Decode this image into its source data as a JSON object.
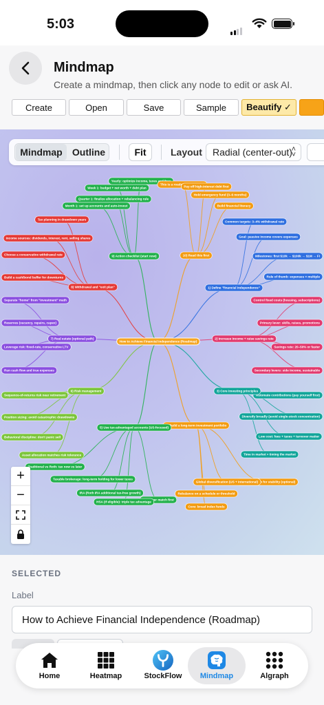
{
  "status": {
    "time": "5:03"
  },
  "header": {
    "title": "Mindmap",
    "subtitle": "Create a mindmap, then click any node to edit or ask AI."
  },
  "toolbar": {
    "create": "Create",
    "open": "Open",
    "save": "Save",
    "sample": "Sample",
    "beautify": "Beautify ✓"
  },
  "view": {
    "mindmap": "Mindmap",
    "outline": "Outline",
    "fit": "Fit",
    "layout_label": "Layout",
    "layout_value": "Radial (center-out)"
  },
  "colors": {
    "root": "#f5a623",
    "blue": "#2f6fe0",
    "pink": "#e23a6e",
    "teal": "#12a59a",
    "orange": "#f39c12",
    "green": "#22b14c",
    "lime": "#7cc53b",
    "purple": "#8a4fe0",
    "red": "#e53935",
    "accent": "#1e88e5"
  },
  "mindmap": {
    "root": "How to Achieve Financial Independence (Roadmap)",
    "branches": [
      {
        "label": "1) Define \"financial independence\"",
        "color": "blue",
        "children": [
          "Common targets: 3–4% withdrawal rate",
          "Goal: passive income covers expenses",
          "Milestones: first $10k → $100k → $1M → FI",
          "Rule of thumb: expenses × multiple"
        ]
      },
      {
        "label": "2) Increase income + raise savings rate",
        "color": "pink",
        "children": [
          "Control fixed costs (housing, subscriptions)",
          "Primary lever: skills, raises, promotions",
          "Savings rate: 20–50% or faster",
          "Secondary levers: side income, sustainable"
        ]
      },
      {
        "label": "3) Core investing principles",
        "color": "teal",
        "children": [
          "Automate contributions (pay yourself first)",
          "Diversify broadly (avoid single-stock concentration)",
          "Low cost: fees + taxes + turnover matter",
          "Time in market > timing the market"
        ]
      },
      {
        "label": "4) Build a long-term investment portfolio",
        "color": "orange",
        "children": [
          "Bond allocation for stability (optional)",
          "Global diversification (US + international)",
          "Rebalance on a schedule or threshold",
          "Core: broad index funds"
        ]
      },
      {
        "label": "5) Use tax-advantaged accounts (US-focused)",
        "color": "green",
        "children": [
          "Employer match first",
          "HSA (if eligible): triple tax advantage",
          "IRA (Roth IRA additional tax-free growth)",
          "Taxable brokerage: long-term holding for lower taxes",
          "Traditional vs Roth: tax now vs later"
        ]
      },
      {
        "label": "6) Risk management",
        "color": "lime",
        "children": [
          "Sequence-of-returns risk near retirement",
          "Position sizing: avoid catastrophic drawdowns",
          "Behavioral discipline: don't panic sell",
          "Asset allocation matches risk tolerance"
        ]
      },
      {
        "label": "7) Real estate (optional path)",
        "color": "purple",
        "children": [
          "Separate \"home\" from \"investment\" math",
          "Reserves (vacancy, repairs, capex)",
          "Leverage risk: fixed-rate, conservative LTV",
          "Run cash flow and true expenses"
        ]
      },
      {
        "label": "8) Withdrawal and \"exit plan\"",
        "color": "red",
        "children": [
          "Tax planning in drawdown years",
          "Income sources: dividends, interest, rent, selling shares",
          "Choose a conservative withdrawal rate",
          "Build a cash/bond buffer for downturns"
        ]
      },
      {
        "label": "9) Action checklist (start now)",
        "color": "green",
        "children": [
          "Week 1: budget + net worth + debt plan",
          "Quarter 1: finalize allocation + rebalancing rule",
          "Month 1: set up accounts and auto-invest",
          "Yearly: optimize income, taxes and fees"
        ]
      },
      {
        "label": "10) Read this first",
        "color": "orange",
        "children": [
          "This is a roadmap, not advice",
          "Pay off high-interest debt first",
          "Hold emergency fund (3–6 months)",
          "Build financial literacy"
        ]
      }
    ]
  },
  "panel": {
    "selected_heading": "SELECTED",
    "label_heading": "Label",
    "label_value": "How to Achieve Financial Independence (Roadmap)"
  },
  "tabs": [
    {
      "label": "Home",
      "icon": "home-icon"
    },
    {
      "label": "Heatmap",
      "icon": "grid-icon"
    },
    {
      "label": "StockFlow",
      "icon": "stockflow-logo-icon"
    },
    {
      "label": "Mindmap",
      "icon": "brain-icon"
    },
    {
      "label": "Algraph",
      "icon": "dots-grid-icon"
    }
  ]
}
